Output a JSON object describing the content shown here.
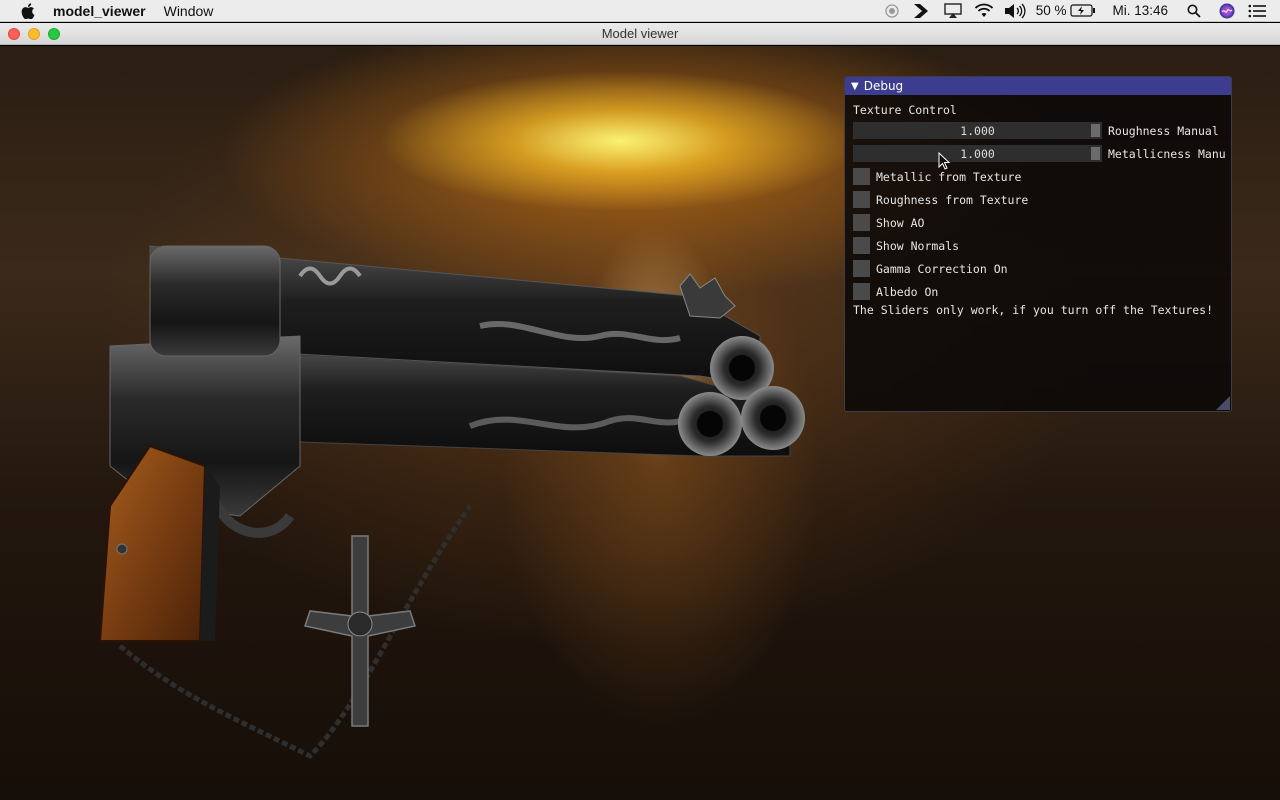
{
  "menubar": {
    "app_name": "model_viewer",
    "menus": [
      "Window"
    ],
    "battery_percent": "50 %",
    "clock": "Mi. 13:46",
    "icons": [
      "apple-logo-icon",
      "screen-record-icon",
      "dash-icon",
      "airplay-icon",
      "wifi-icon",
      "volume-icon",
      "battery-charging-icon",
      "spotlight-search-icon",
      "siri-icon",
      "notification-center-icon"
    ]
  },
  "window": {
    "title": "Model viewer"
  },
  "debug_panel": {
    "title": "Debug",
    "section_label": "Texture Control",
    "sliders": [
      {
        "value": "1.000",
        "label": "Roughness Manual"
      },
      {
        "value": "1.000",
        "label": "Metallicness Manu"
      }
    ],
    "checkboxes": [
      {
        "label": "Metallic from Texture",
        "checked": false
      },
      {
        "label": "Roughness from Texture",
        "checked": false
      },
      {
        "label": "Show AO",
        "checked": false
      },
      {
        "label": "Show Normals",
        "checked": false
      },
      {
        "label": "Gamma Correction On",
        "checked": false
      },
      {
        "label": "Albedo On",
        "checked": false
      }
    ],
    "note": "The Sliders only work, if you turn off the Textures!"
  },
  "colors": {
    "imgui_title_bg": "#3d3d8f",
    "imgui_window_bg": "#0a0808",
    "slider_bg": "#2e2e2e",
    "checkbox_bg": "#4a4a4a"
  }
}
